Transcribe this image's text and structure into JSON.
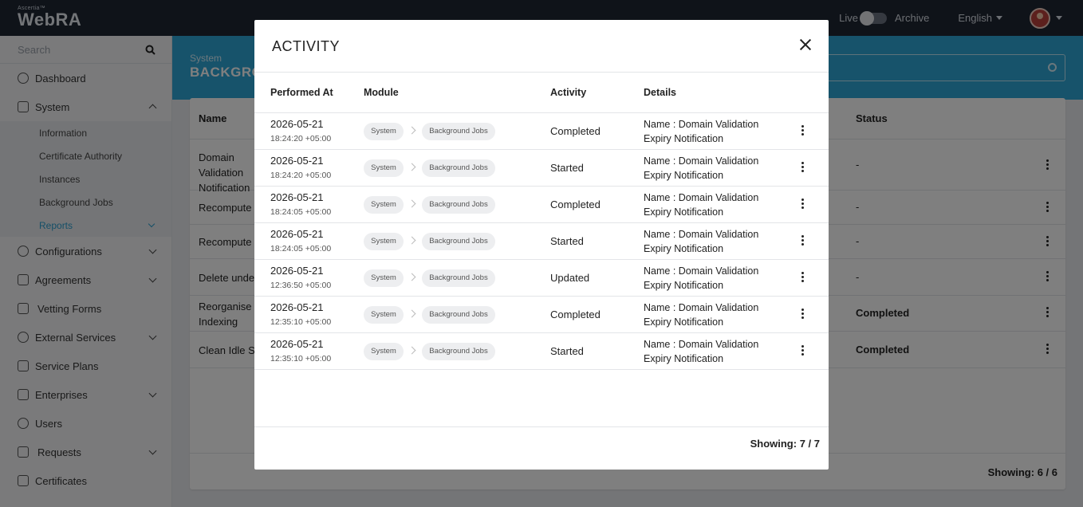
{
  "topbar": {
    "brand_small": "Ascertia™",
    "brand": "WebRA",
    "live_label": "Live",
    "archive_label": "Archive",
    "language": "English"
  },
  "sidebar": {
    "search_placeholder": "Search",
    "items": [
      {
        "label": "Dashboard"
      },
      {
        "label": "System"
      },
      {
        "label": "Configurations"
      },
      {
        "label": "Agreements"
      },
      {
        "label": "Vetting Forms"
      },
      {
        "label": "External Services"
      },
      {
        "label": "Service Plans"
      },
      {
        "label": "Enterprises"
      },
      {
        "label": "Users"
      },
      {
        "label": "Requests"
      },
      {
        "label": "Certificates"
      }
    ],
    "system_sub": [
      {
        "label": "Information"
      },
      {
        "label": "Certificate Authority"
      },
      {
        "label": "Instances"
      },
      {
        "label": "Background Jobs"
      },
      {
        "label": "Reports"
      }
    ]
  },
  "main": {
    "crumb": "System",
    "title": "BACKGRO",
    "col_name": "Name",
    "col_status": "Status",
    "rows": [
      {
        "name": "Domain Validation Notification",
        "status": "-"
      },
      {
        "name": "Recompute I",
        "status": "-"
      },
      {
        "name": "Recompute U",
        "status": "-"
      },
      {
        "name": "Delete undel",
        "status": "-"
      },
      {
        "name": "Reorganise Indexing",
        "status": "Completed"
      },
      {
        "name": "Clean Idle Se",
        "status": "Completed"
      }
    ],
    "footer": "Showing:  6 / 6"
  },
  "modal": {
    "title": "ACTIVITY",
    "columns": {
      "performed_at": "Performed At",
      "module": "Module",
      "activity": "Activity",
      "details": "Details"
    },
    "rows": [
      {
        "date": "2026-05-21",
        "time": "18:24:20 +05:00",
        "module": "System",
        "submodule": "Background Jobs",
        "activity": "Completed",
        "details": "Name : Domain Validation Expiry Notification"
      },
      {
        "date": "2026-05-21",
        "time": "18:24:20 +05:00",
        "module": "System",
        "submodule": "Background Jobs",
        "activity": "Started",
        "details": "Name : Domain Validation Expiry Notification"
      },
      {
        "date": "2026-05-21",
        "time": "18:24:05 +05:00",
        "module": "System",
        "submodule": "Background Jobs",
        "activity": "Completed",
        "details": "Name : Domain Validation Expiry Notification"
      },
      {
        "date": "2026-05-21",
        "time": "18:24:05 +05:00",
        "module": "System",
        "submodule": "Background Jobs",
        "activity": "Started",
        "details": "Name : Domain Validation Expiry Notification"
      },
      {
        "date": "2026-05-21",
        "time": "12:36:50 +05:00",
        "module": "System",
        "submodule": "Background Jobs",
        "activity": "Updated",
        "details": "Name : Domain Validation Expiry Notification"
      },
      {
        "date": "2026-05-21",
        "time": "12:35:10 +05:00",
        "module": "System",
        "submodule": "Background Jobs",
        "activity": "Completed",
        "details": "Name : Domain Validation Expiry Notification"
      },
      {
        "date": "2026-05-21",
        "time": "12:35:10 +05:00",
        "module": "System",
        "submodule": "Background Jobs",
        "activity": "Started",
        "details": "Name : Domain Validation Expiry Notification"
      }
    ],
    "footer": "Showing:  7 / 7"
  }
}
